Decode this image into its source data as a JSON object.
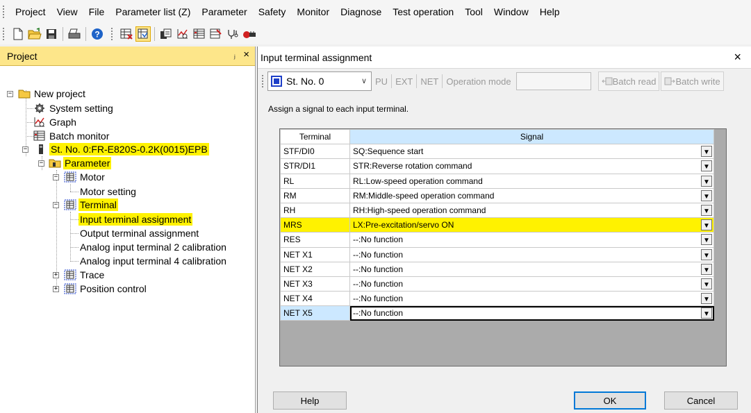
{
  "menu": [
    "Project",
    "View",
    "File",
    "Parameter list (Z)",
    "Parameter",
    "Safety",
    "Monitor",
    "Diagnose",
    "Test operation",
    "Tool",
    "Window",
    "Help"
  ],
  "project_panel": {
    "title": "Project",
    "pin_glyph": "ⱼ",
    "close_glyph": "×",
    "tree": {
      "root": "New project",
      "system_setting": "System setting",
      "graph": "Graph",
      "batch_monitor": "Batch monitor",
      "station": "St. No. 0:FR-E820S-0.2K(0015)EPB",
      "parameter": "Parameter",
      "motor": "Motor",
      "motor_setting": "Motor setting",
      "terminal": "Terminal",
      "input_terminal": "Input terminal assignment",
      "output_terminal": "Output terminal assignment",
      "analog2": "Analog input terminal 2 calibration",
      "analog4": "Analog input terminal 4 calibration",
      "trace": "Trace",
      "position_control": "Position control"
    }
  },
  "dialog": {
    "title": "Input terminal assignment",
    "close_glyph": "×",
    "station_select": "St. No. 0",
    "modes": [
      "PU",
      "EXT",
      "NET"
    ],
    "operation_mode_label": "Operation mode",
    "batch_read": "Batch read",
    "batch_write": "Batch write",
    "instruction": "Assign a signal to each input terminal.",
    "columns": {
      "terminal": "Terminal",
      "signal": "Signal"
    },
    "rows": [
      {
        "terminal": "STF/DI0",
        "signal": "SQ:Sequence start"
      },
      {
        "terminal": "STR/DI1",
        "signal": "STR:Reverse rotation command"
      },
      {
        "terminal": "RL",
        "signal": "RL:Low-speed operation command"
      },
      {
        "terminal": "RM",
        "signal": "RM:Middle-speed operation command"
      },
      {
        "terminal": "RH",
        "signal": "RH:High-speed operation command"
      },
      {
        "terminal": "MRS",
        "signal": "LX:Pre-excitation/servo ON"
      },
      {
        "terminal": "RES",
        "signal": "--:No function"
      },
      {
        "terminal": "NET X1",
        "signal": "--:No function"
      },
      {
        "terminal": "NET X2",
        "signal": "--:No function"
      },
      {
        "terminal": "NET X3",
        "signal": "--:No function"
      },
      {
        "terminal": "NET X4",
        "signal": "--:No function"
      },
      {
        "terminal": "NET X5",
        "signal": "--:No function"
      }
    ],
    "buttons": {
      "help": "Help",
      "ok": "OK",
      "cancel": "Cancel"
    }
  },
  "colors": {
    "highlight": "#fff200",
    "panel_header": "#fde68a",
    "selection": "#cce8ff"
  }
}
